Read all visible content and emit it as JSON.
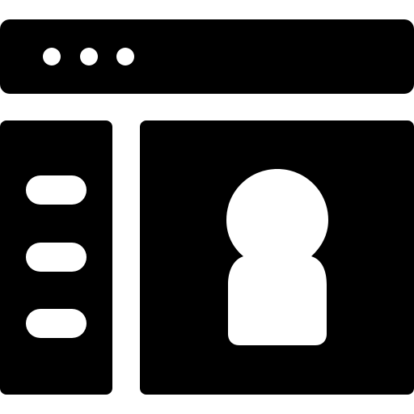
{
  "icon": {
    "name": "browser-profile-page",
    "colors": {
      "foreground": "#000000",
      "background": "#ffffff"
    },
    "title_bar": {
      "dots": 3
    },
    "sidebar": {
      "lines": 3
    },
    "content": {
      "figure": "user-avatar"
    }
  }
}
